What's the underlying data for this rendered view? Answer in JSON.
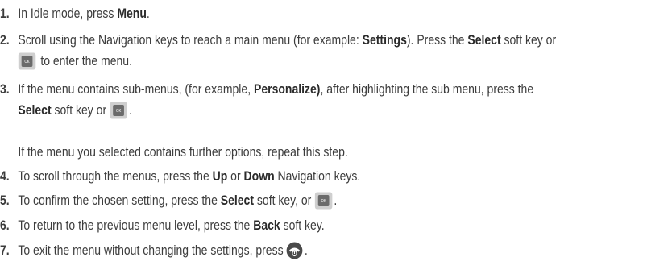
{
  "steps": [
    {
      "number": "1.",
      "lines": [
        [
          {
            "t": "In Idle mode, press "
          },
          {
            "t": "Menu",
            "b": true
          },
          {
            "t": "."
          }
        ]
      ]
    },
    {
      "number": "2.",
      "lines": [
        [
          {
            "t": "Scroll using the Navigation keys to reach a main menu (for example: "
          },
          {
            "t": "Settings",
            "b": true
          },
          {
            "t": "). Press the "
          },
          {
            "t": "Select",
            "b": true
          },
          {
            "t": " soft key or"
          }
        ],
        [
          {
            "icon": "ok-key-icon"
          },
          {
            "t": " to enter the menu."
          }
        ]
      ]
    },
    {
      "number": "3.",
      "lines": [
        [
          {
            "t": "If the menu contains sub-menus, (for example, "
          },
          {
            "t": "Personalize)",
            "b": true
          },
          {
            "t": ", after highlighting the sub menu, press the"
          }
        ],
        [
          {
            "t": "Select",
            "b": true
          },
          {
            "t": " soft key or "
          },
          {
            "icon": "ok-key-icon"
          },
          {
            "t": "."
          }
        ],
        [],
        [
          {
            "t": "If the menu you selected contains further options, repeat this step."
          }
        ]
      ]
    },
    {
      "number": "4.",
      "lines": [
        [
          {
            "t": "To scroll through the menus, press the "
          },
          {
            "t": "Up",
            "b": true
          },
          {
            "t": " or "
          },
          {
            "t": "Down",
            "b": true
          },
          {
            "t": " Navigation keys."
          }
        ]
      ]
    },
    {
      "number": "5.",
      "lines": [
        [
          {
            "t": "To confirm the chosen setting, press the "
          },
          {
            "t": "Select",
            "b": true
          },
          {
            "t": " soft key, or "
          },
          {
            "icon": "ok-key-icon"
          },
          {
            "t": "."
          }
        ]
      ]
    },
    {
      "number": "6.",
      "lines": [
        [
          {
            "t": "To return to the previous menu level, press the "
          },
          {
            "t": "Back",
            "b": true
          },
          {
            "t": " soft key."
          }
        ]
      ]
    },
    {
      "number": "7.",
      "lines": [
        [
          {
            "t": "To exit the menu without changing the settings, press "
          },
          {
            "icon": "end-key-icon"
          },
          {
            "t": "."
          }
        ]
      ]
    }
  ],
  "icons": {
    "ok-key-icon": {
      "label": "OK",
      "face": "#6b6b6b",
      "frame": "#cfcfcf"
    },
    "end-key-icon": {
      "face": "#4a4a4a"
    }
  },
  "colors": {
    "text": "#3c3c3c",
    "bold": "#2a2a2a"
  }
}
